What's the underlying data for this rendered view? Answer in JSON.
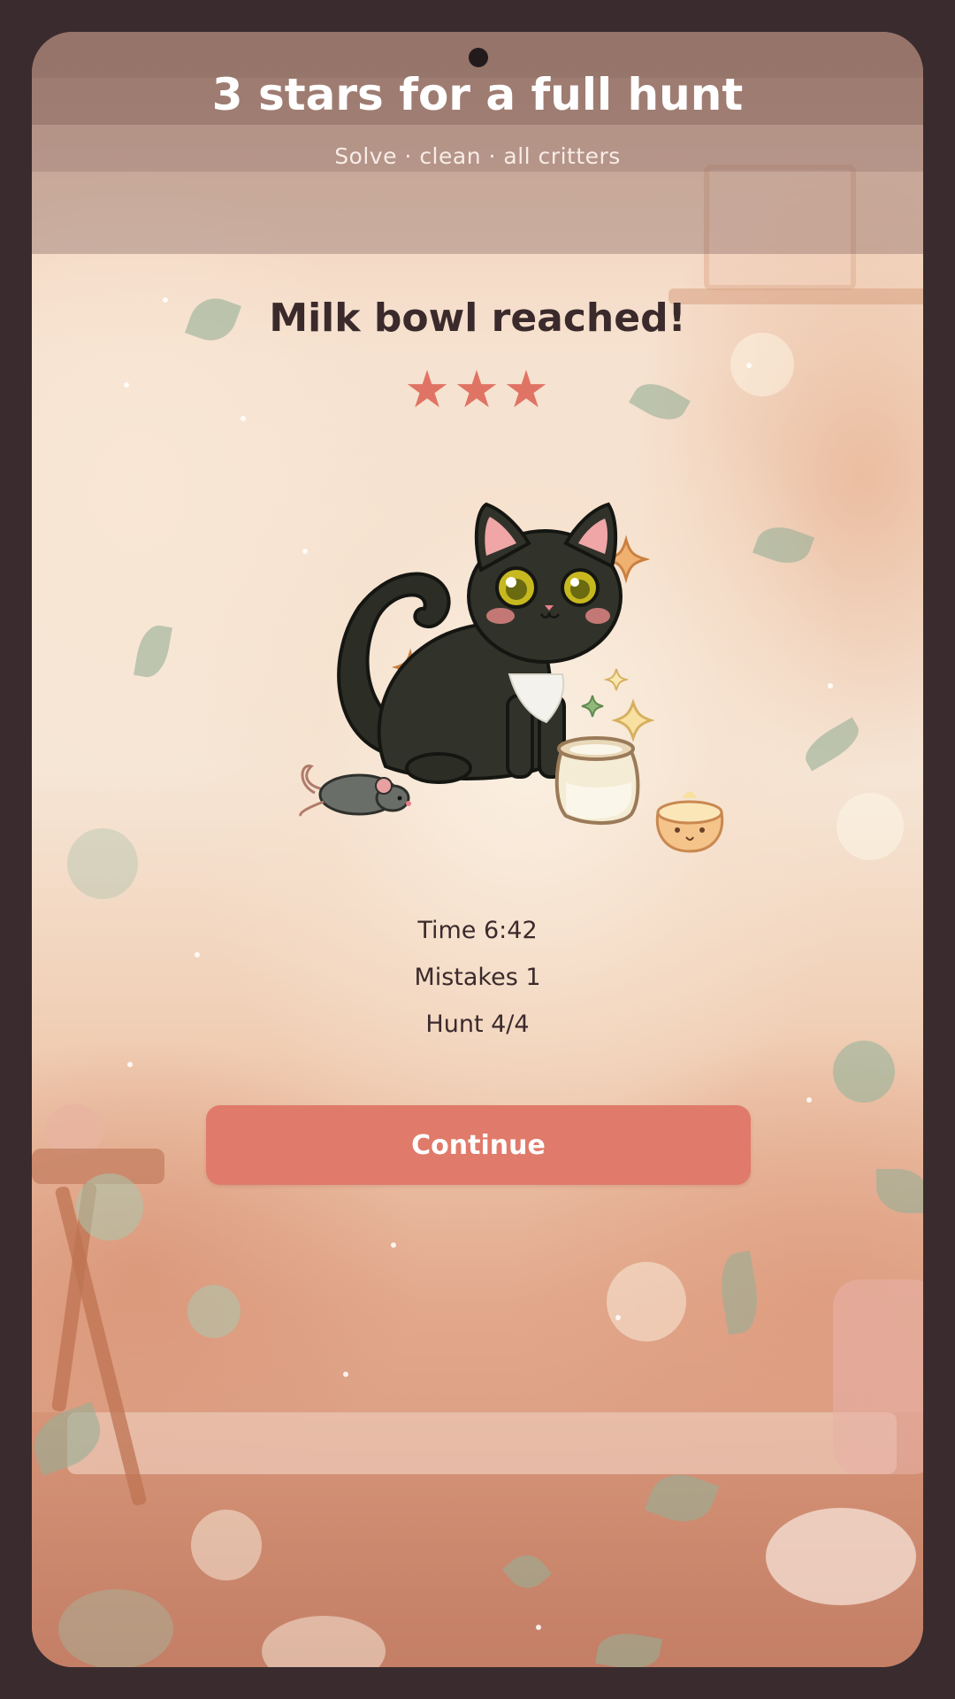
{
  "header": {
    "title": "3 stars for a full hunt",
    "subtitle": "Solve · clean · all critters"
  },
  "result": {
    "title": "Milk bowl reached!",
    "stars_earned": 3,
    "stars_total": 3,
    "star_glyph": "★",
    "star_color": "#e07464"
  },
  "illustration": {
    "icons": [
      "black-cat-icon",
      "mouse-icon",
      "milk-jar-icon",
      "pudding-icon",
      "sparkle-icon"
    ]
  },
  "stats": {
    "time": "Time 6:42",
    "mistakes": "Mistakes 1",
    "hunt": "Hunt 4/4"
  },
  "actions": {
    "continue_label": "Continue",
    "continue_color": "#e07a6a"
  }
}
